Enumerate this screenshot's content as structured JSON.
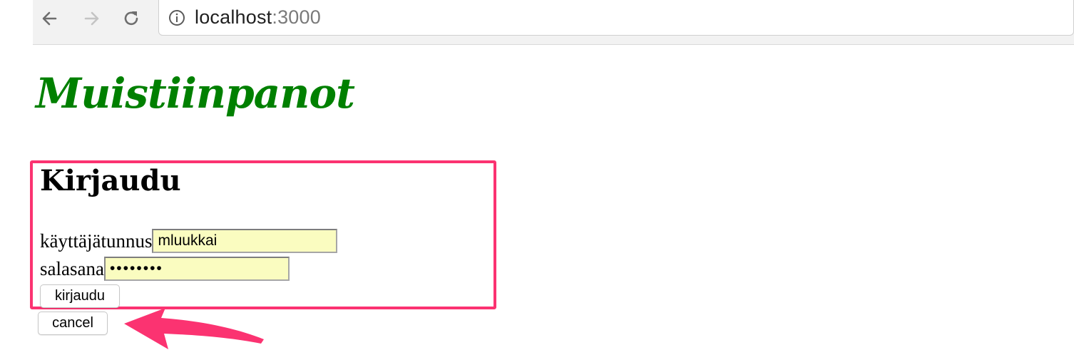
{
  "browser": {
    "url_host": "localhost",
    "url_port": ":3000",
    "icons": {
      "back": "back-arrow-icon",
      "forward": "forward-arrow-icon",
      "reload": "reload-icon",
      "info": "info-icon"
    }
  },
  "page": {
    "title": "Muistiinpanot",
    "title_color": "#008000"
  },
  "login": {
    "heading": "Kirjaudu",
    "username_label": "käyttäjätunnus",
    "username_value": "mluukkai",
    "password_label": "salasana",
    "password_value": "••••••••",
    "submit_label": "kirjaudu",
    "highlight_color": "#fb3371"
  },
  "actions": {
    "cancel_label": "cancel"
  },
  "annotation": {
    "arrow_color": "#fb3371",
    "arrow_icon": "annotation-arrow-icon"
  }
}
